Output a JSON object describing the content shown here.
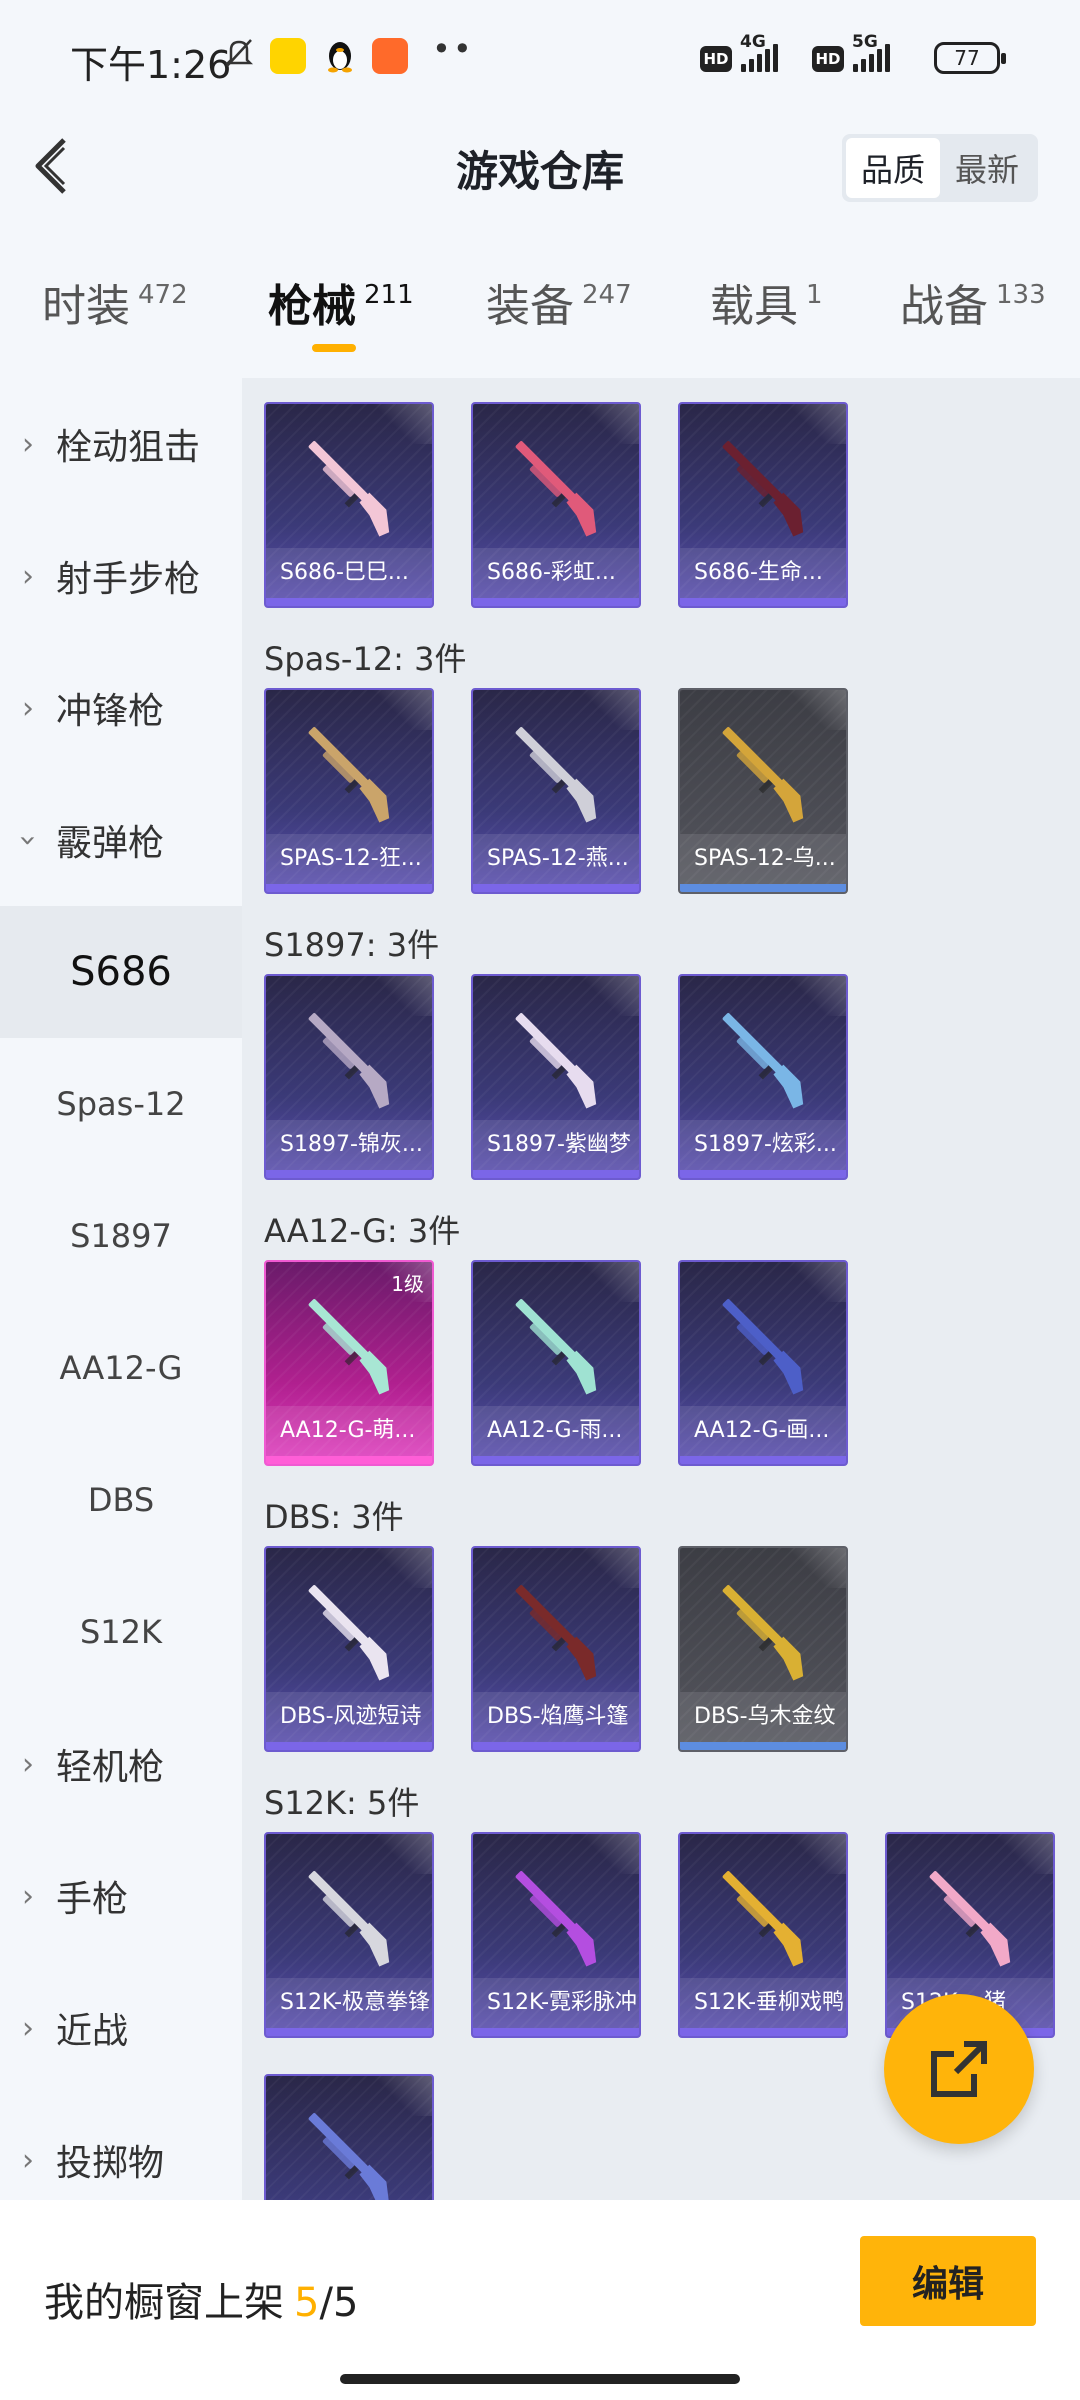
{
  "status_bar": {
    "time": "下午1:26",
    "network1": "4G",
    "network2": "5G",
    "battery": "77"
  },
  "header": {
    "title": "游戏仓库",
    "sort_options": [
      "品质",
      "最新"
    ],
    "sort_selected": "品质"
  },
  "tabs": [
    {
      "label": "时装",
      "count": "472"
    },
    {
      "label": "枪械",
      "count": "211"
    },
    {
      "label": "装备",
      "count": "247"
    },
    {
      "label": "载具",
      "count": "1"
    },
    {
      "label": "战备",
      "count": "133"
    }
  ],
  "active_tab": "枪械",
  "sidebar": {
    "categories": [
      {
        "label": "栓动狙击",
        "expanded": false
      },
      {
        "label": "射手步枪",
        "expanded": false
      },
      {
        "label": "冲锋枪",
        "expanded": false
      },
      {
        "label": "霰弹枪",
        "expanded": true
      },
      {
        "label": "轻机枪",
        "expanded": false
      },
      {
        "label": "手枪",
        "expanded": false
      },
      {
        "label": "近战",
        "expanded": false
      },
      {
        "label": "投掷物",
        "expanded": false
      }
    ],
    "subcategories": [
      "S686",
      "Spas-12",
      "S1897",
      "AA12-G",
      "DBS",
      "S12K"
    ],
    "selected_sub": "S686"
  },
  "groups": [
    {
      "title": "",
      "items": [
        {
          "name": "S686-巳巳...",
          "style": "purple",
          "gun_color": "#f3c6d6"
        },
        {
          "name": "S686-彩虹...",
          "style": "purple",
          "gun_color": "#e05a7a"
        },
        {
          "name": "S686-生命...",
          "style": "purple",
          "gun_color": "#6b2030"
        }
      ]
    },
    {
      "title": "Spas-12: 3件",
      "items": [
        {
          "name": "SPAS-12-狂...",
          "style": "purple",
          "gun_color": "#caa46a"
        },
        {
          "name": "SPAS-12-燕...",
          "style": "purple",
          "gun_color": "#cfcfd8"
        },
        {
          "name": "SPAS-12-乌...",
          "style": "gray",
          "gun_color": "#d4a53a"
        }
      ]
    },
    {
      "title": "S1897: 3件",
      "items": [
        {
          "name": "S1897-锦灰...",
          "style": "purple",
          "gun_color": "#b6a9c4"
        },
        {
          "name": "S1897-紫幽梦",
          "style": "purple",
          "gun_color": "#e7dcef"
        },
        {
          "name": "S1897-炫彩...",
          "style": "purple",
          "gun_color": "#7ab6e6"
        }
      ]
    },
    {
      "title": "AA12-G: 3件",
      "items": [
        {
          "name": "AA12-G-萌...",
          "style": "pink",
          "gun_color": "#a8e6d4",
          "level": "1级"
        },
        {
          "name": "AA12-G-雨...",
          "style": "purple",
          "gun_color": "#9fe2d2"
        },
        {
          "name": "AA12-G-画...",
          "style": "purple",
          "gun_color": "#4d5fc8"
        }
      ]
    },
    {
      "title": "DBS: 3件",
      "items": [
        {
          "name": "DBS-风迹短诗",
          "style": "purple",
          "gun_color": "#eae4f0"
        },
        {
          "name": "DBS-焰鹰斗篷",
          "style": "purple",
          "gun_color": "#7a2a2a"
        },
        {
          "name": "DBS-乌木金纹",
          "style": "gray",
          "gun_color": "#d9b033"
        }
      ]
    },
    {
      "title": "S12K: 5件",
      "items": [
        {
          "name": "S12K-极意拳锋",
          "style": "purple",
          "gun_color": "#d7d7de"
        },
        {
          "name": "S12K-霓彩脉冲",
          "style": "purple",
          "gun_color": "#b44ee0"
        },
        {
          "name": "S12K-垂柳戏鸭",
          "style": "purple",
          "gun_color": "#e4b032"
        },
        {
          "name": "S12K-...猪",
          "style": "purple",
          "gun_color": "#f2a9c8"
        },
        {
          "name": "",
          "style": "purple",
          "gun_color": "#6a7bd8"
        }
      ]
    }
  ],
  "bottom": {
    "label": "我的橱窗上架",
    "used": "5",
    "slash": "/",
    "total": "5",
    "edit_button": "编辑"
  }
}
